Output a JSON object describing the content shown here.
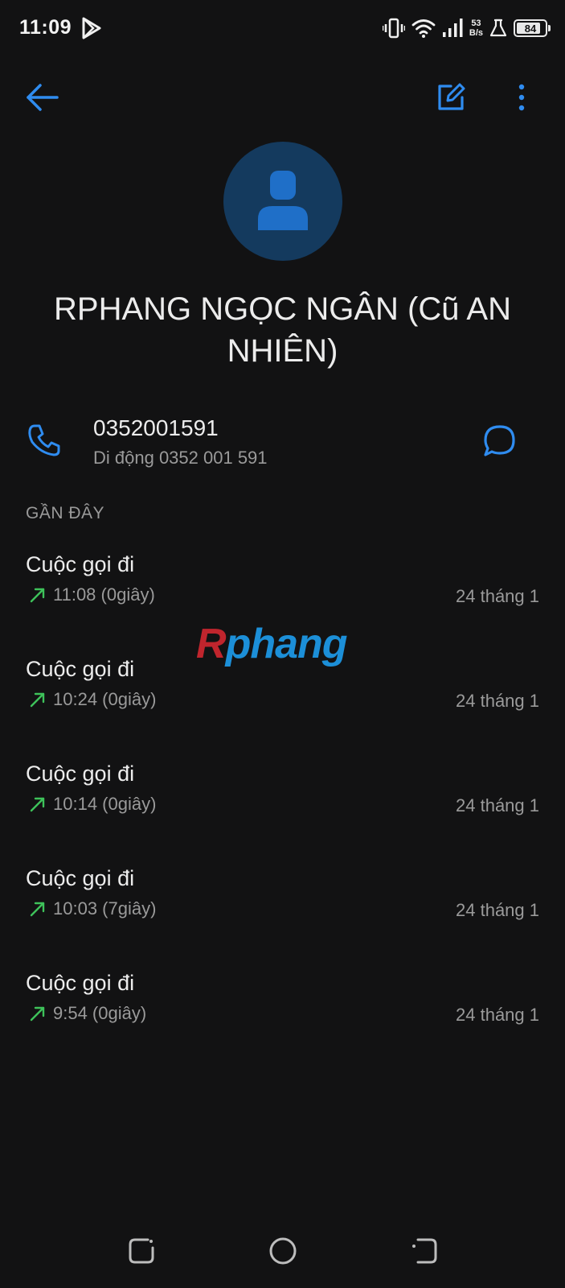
{
  "status_bar": {
    "time": "11:09",
    "net_speed_value": "53",
    "net_speed_unit": "B/s",
    "battery_level": "84",
    "battery_fraction": 0.84,
    "icons": [
      "play-store-icon",
      "vibrate-icon",
      "wifi-icon",
      "signal-icon",
      "lab-icon",
      "battery-icon"
    ]
  },
  "toolbar": {
    "back_icon": "arrow-left-icon",
    "edit_icon": "edit-icon",
    "more_icon": "more-vert-icon"
  },
  "contact": {
    "name": "RPHANG NGỌC NGÂN (Cũ AN NHIÊN)",
    "phone_number": "0352001591",
    "phone_detail": "Di động 0352 001 591"
  },
  "recent": {
    "header": "GẦN ĐÂY",
    "calls": [
      {
        "type": "Cuộc gọi đi",
        "time": "11:08 (0giây)",
        "date": "24 tháng 1"
      },
      {
        "type": "Cuộc gọi đi",
        "time": "10:24 (0giây)",
        "date": "24 tháng 1"
      },
      {
        "type": "Cuộc gọi đi",
        "time": "10:14 (0giây)",
        "date": "24 tháng 1"
      },
      {
        "type": "Cuộc gọi đi",
        "time": "10:03 (7giây)",
        "date": "24 tháng 1"
      },
      {
        "type": "Cuộc gọi đi",
        "time": "9:54 (0giây)",
        "date": "24 tháng 1"
      }
    ]
  },
  "watermark": {
    "first_letter": "R",
    "rest": "phang"
  },
  "colors": {
    "background": "#121213",
    "accent": "#2f8cf0",
    "outgoing_arrow": "#3ec25a",
    "avatar_bg": "#143a5e",
    "avatar_fg": "#1f6fc8"
  }
}
